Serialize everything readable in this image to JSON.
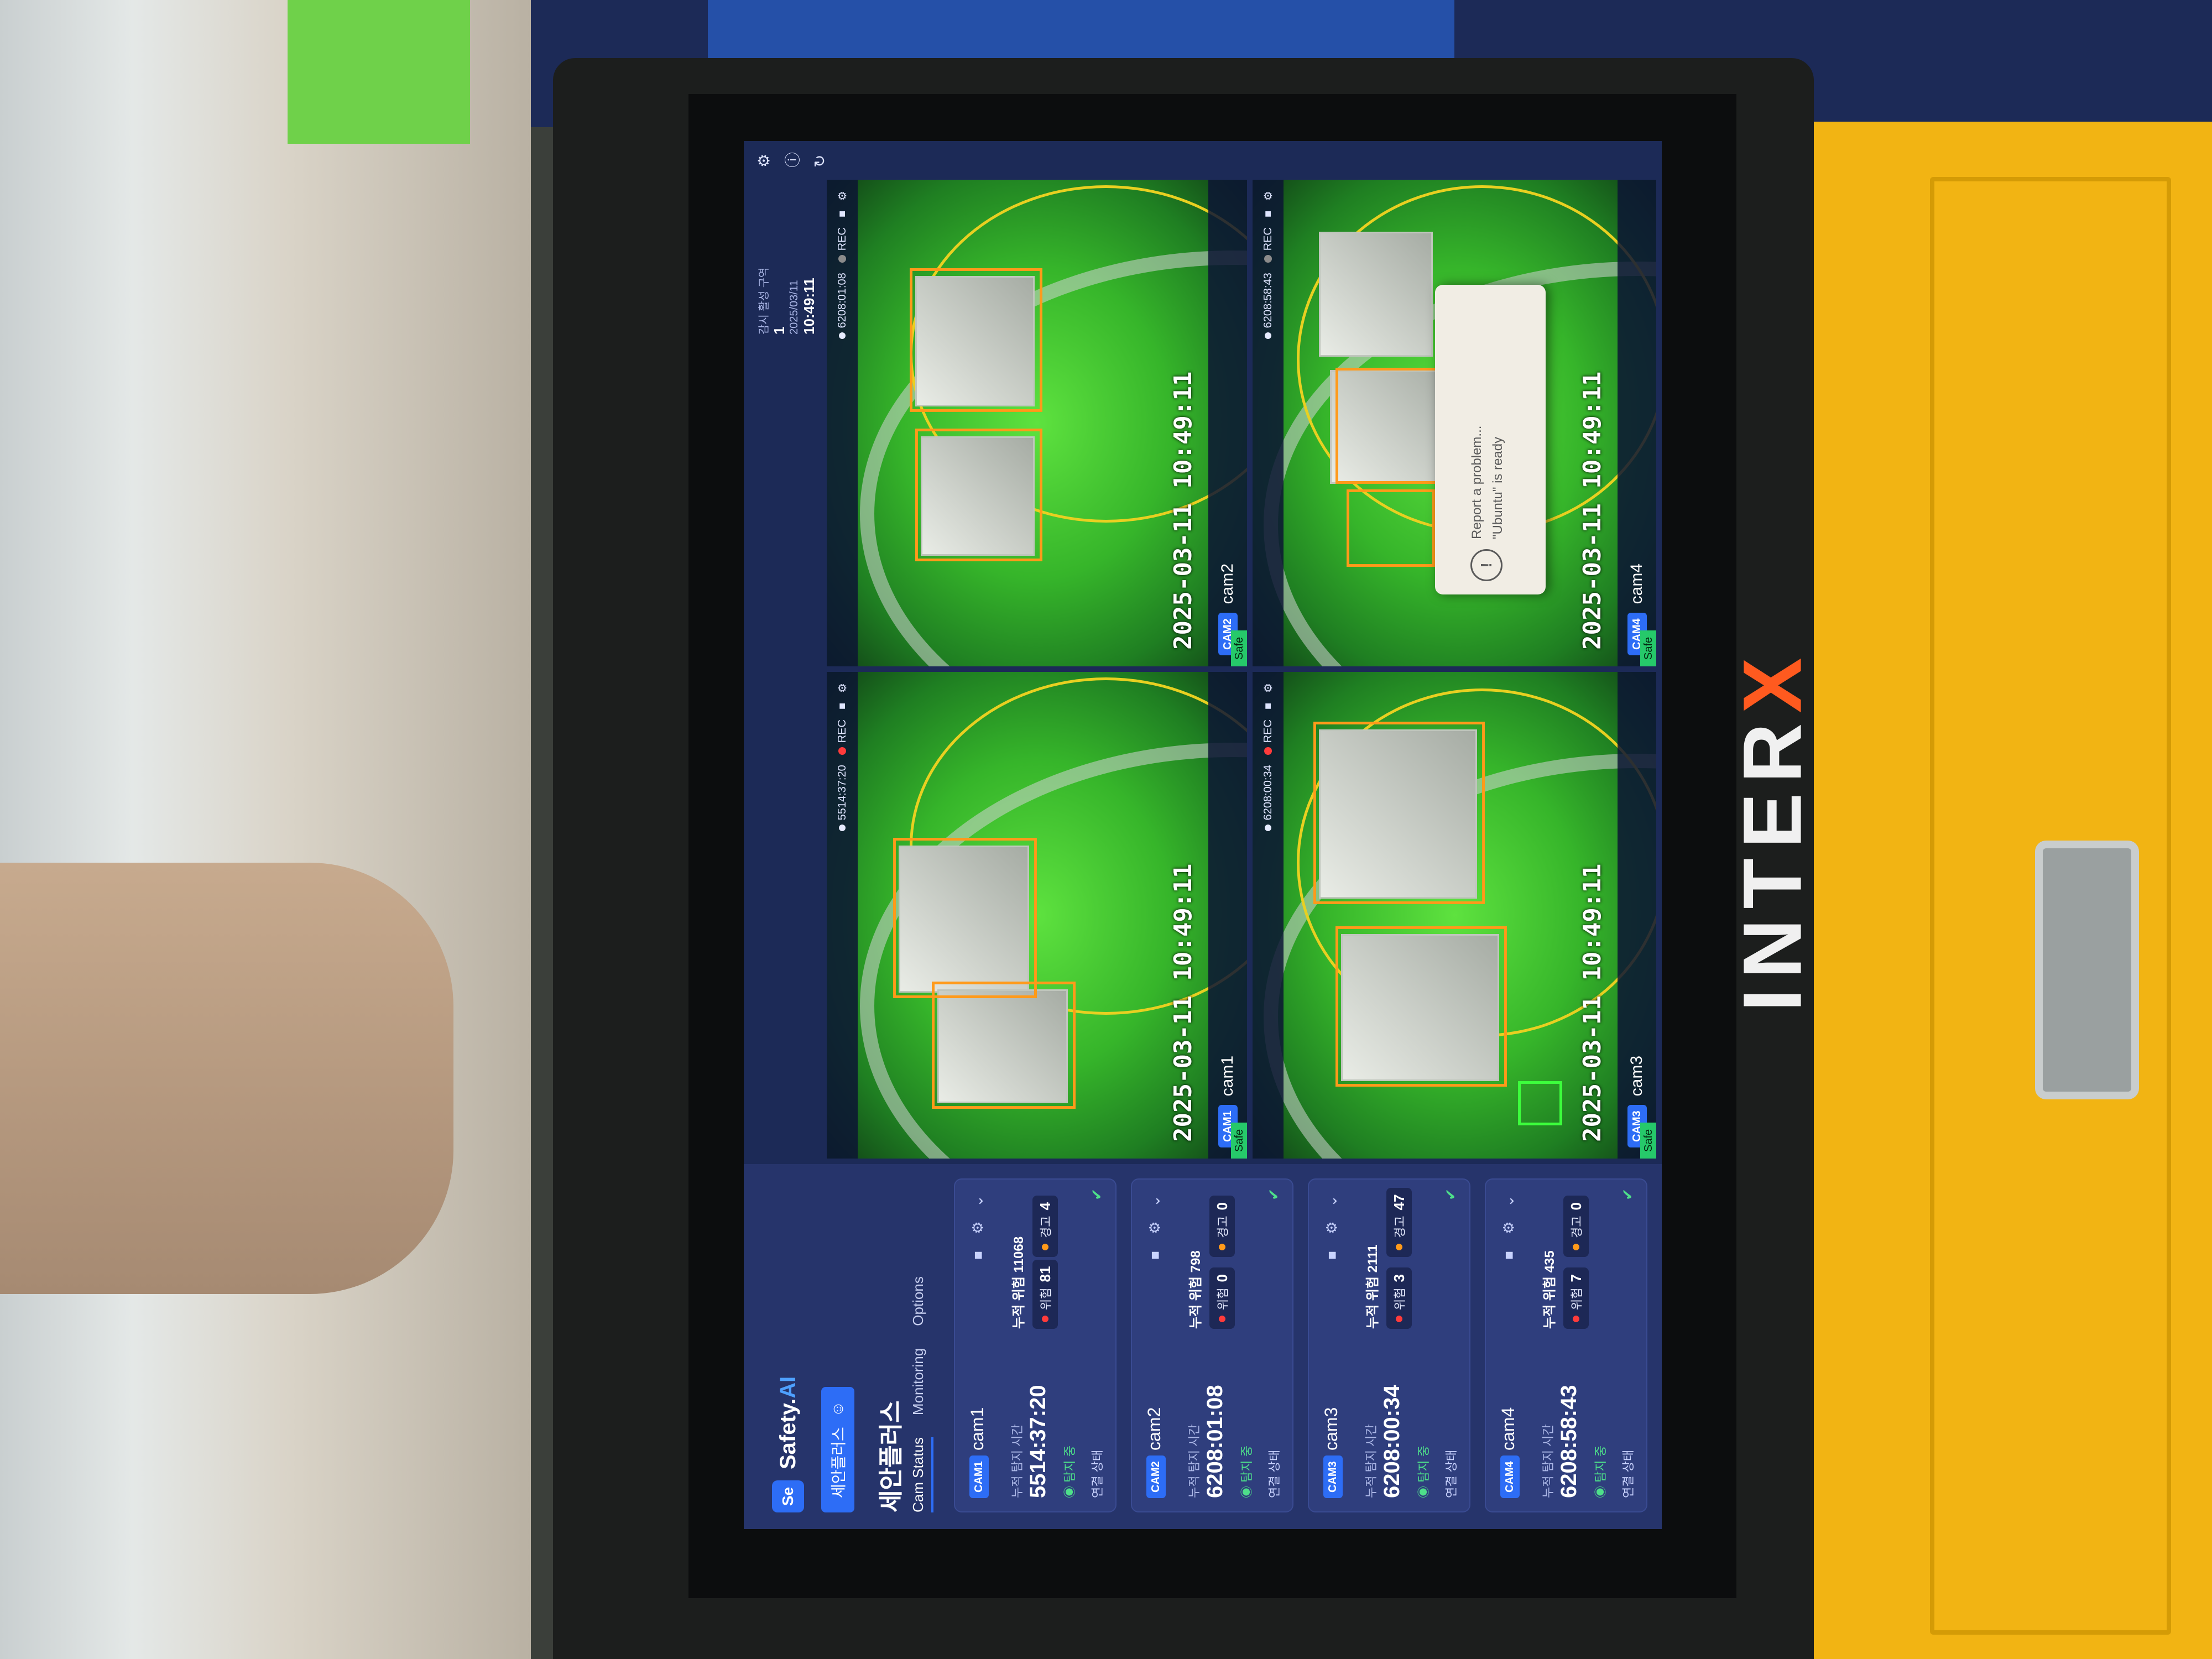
{
  "brand": {
    "monitor_brand_main": "INTER",
    "monitor_brand_x": "X"
  },
  "app": {
    "logo_mark": "Se",
    "name_main": "Safety.",
    "name_ai": "AI",
    "company_button": "세안플러스",
    "company_button_icon": "user-icon",
    "page_title": "세안플러스",
    "tabs": [
      "Cam Status",
      "Monitoring",
      "Options"
    ],
    "active_tab": "Cam Status"
  },
  "header": {
    "counter_label": "감시 활성 구역",
    "counter_value": "1",
    "date": "2025/03/11",
    "time": "10:49:11",
    "icons": [
      "gear-icon",
      "help-icon",
      "refresh-icon"
    ]
  },
  "cameras": [
    {
      "tag": "CAM1",
      "name": "cam1",
      "time_label": "누적 탐지 시간",
      "time": "5514:37:20",
      "status": "탐지 중",
      "risk_label": "누적 위험 11068",
      "pill1_label": "위험",
      "pill1_value": "81",
      "pill2_label": "경고",
      "pill2_value": "4",
      "footer_label": "연결 상태"
    },
    {
      "tag": "CAM2",
      "name": "cam2",
      "time_label": "누적 탐지 시간",
      "time": "6208:01:08",
      "status": "탐지 중",
      "risk_label": "누적 위험 798",
      "pill1_label": "위험",
      "pill1_value": "0",
      "pill2_label": "경고",
      "pill2_value": "0",
      "footer_label": "연결 상태"
    },
    {
      "tag": "CAM3",
      "name": "cam3",
      "time_label": "누적 탐지 시간",
      "time": "6208:00:34",
      "status": "탐지 중",
      "risk_label": "누적 위험 2111",
      "pill1_label": "위험",
      "pill1_value": "3",
      "pill2_label": "경고",
      "pill2_value": "47",
      "footer_label": "연결 상태"
    },
    {
      "tag": "CAM4",
      "name": "cam4",
      "time_label": "누적 탐지 시간",
      "time": "6208:58:43",
      "status": "탐지 중",
      "risk_label": "누적 위험 435",
      "pill1_label": "위험",
      "pill1_value": "7",
      "pill2_label": "경고",
      "pill2_value": "0",
      "footer_label": "연결 상태"
    }
  ],
  "videos": [
    {
      "tag": "CAM1",
      "name": "cam1",
      "status": "Safe",
      "rec": "REC",
      "rec_active": true,
      "clock": "5514:37:20",
      "stamp": "2025-03-11 10:49:11"
    },
    {
      "tag": "CAM2",
      "name": "cam2",
      "status": "Safe",
      "rec": "REC",
      "rec_active": false,
      "clock": "6208:01:08",
      "stamp": "2025-03-11 10:49:11"
    },
    {
      "tag": "CAM3",
      "name": "cam3",
      "status": "Safe",
      "rec": "REC",
      "rec_active": true,
      "clock": "6208:00:34",
      "stamp": "2025-03-11 10:49:11"
    },
    {
      "tag": "CAM4",
      "name": "cam4",
      "status": "Safe",
      "rec": "REC",
      "rec_active": false,
      "clock": "6208:58:43",
      "stamp": "2025-03-11 10:49:11"
    }
  ],
  "toast": {
    "icon": "alert-icon",
    "line1": "Report a problem...",
    "line2": "\"Ubuntu\" is ready"
  },
  "colors": {
    "accent": "#2d6df6",
    "safe": "#26c96a",
    "danger": "#ff3b3b",
    "warning": "#ff9a1a",
    "screen_bg": "#1c2a57"
  }
}
